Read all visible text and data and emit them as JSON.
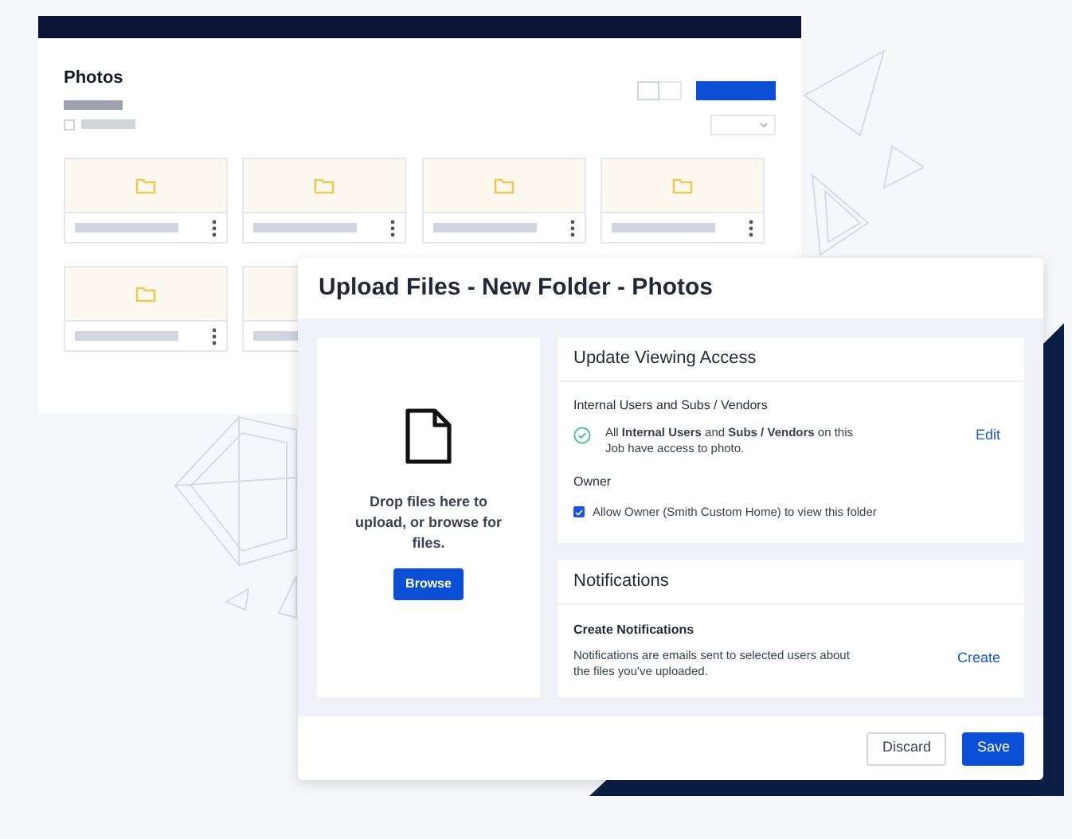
{
  "photos_window": {
    "title": "Photos",
    "select_all_checkbox": {
      "checked": false
    },
    "cards": [
      {
        "kind": "folder"
      },
      {
        "kind": "folder"
      },
      {
        "kind": "folder"
      },
      {
        "kind": "folder"
      },
      {
        "kind": "folder"
      },
      {
        "kind": "folder_partly_hidden"
      }
    ]
  },
  "upload_dialog": {
    "title": "Upload Files - New Folder - Photos",
    "drop_zone": {
      "text": "Drop files here to upload, or browse for files.",
      "button": "Browse"
    },
    "viewing_access": {
      "heading": "Update Viewing Access",
      "subheading": "Internal Users and Subs / Vendors",
      "description": "All **Internal Users** and **Subs / Vendors** on this Job have access to photo.",
      "link": "Edit",
      "owner_label": "Owner",
      "owner_checkbox": {
        "label": "Allow Owner (Smith Custom Home) to view this folder",
        "checked": true
      }
    },
    "notifications": {
      "heading": "Notifications",
      "subheading": "Create Notifications",
      "description": "Notifications are emails sent to selected users about the files you've uploaded.",
      "link": "Create"
    },
    "buttons": [
      {
        "label": "Discard",
        "kind": "secondary"
      },
      {
        "label": "Save",
        "kind": "primary"
      }
    ]
  }
}
